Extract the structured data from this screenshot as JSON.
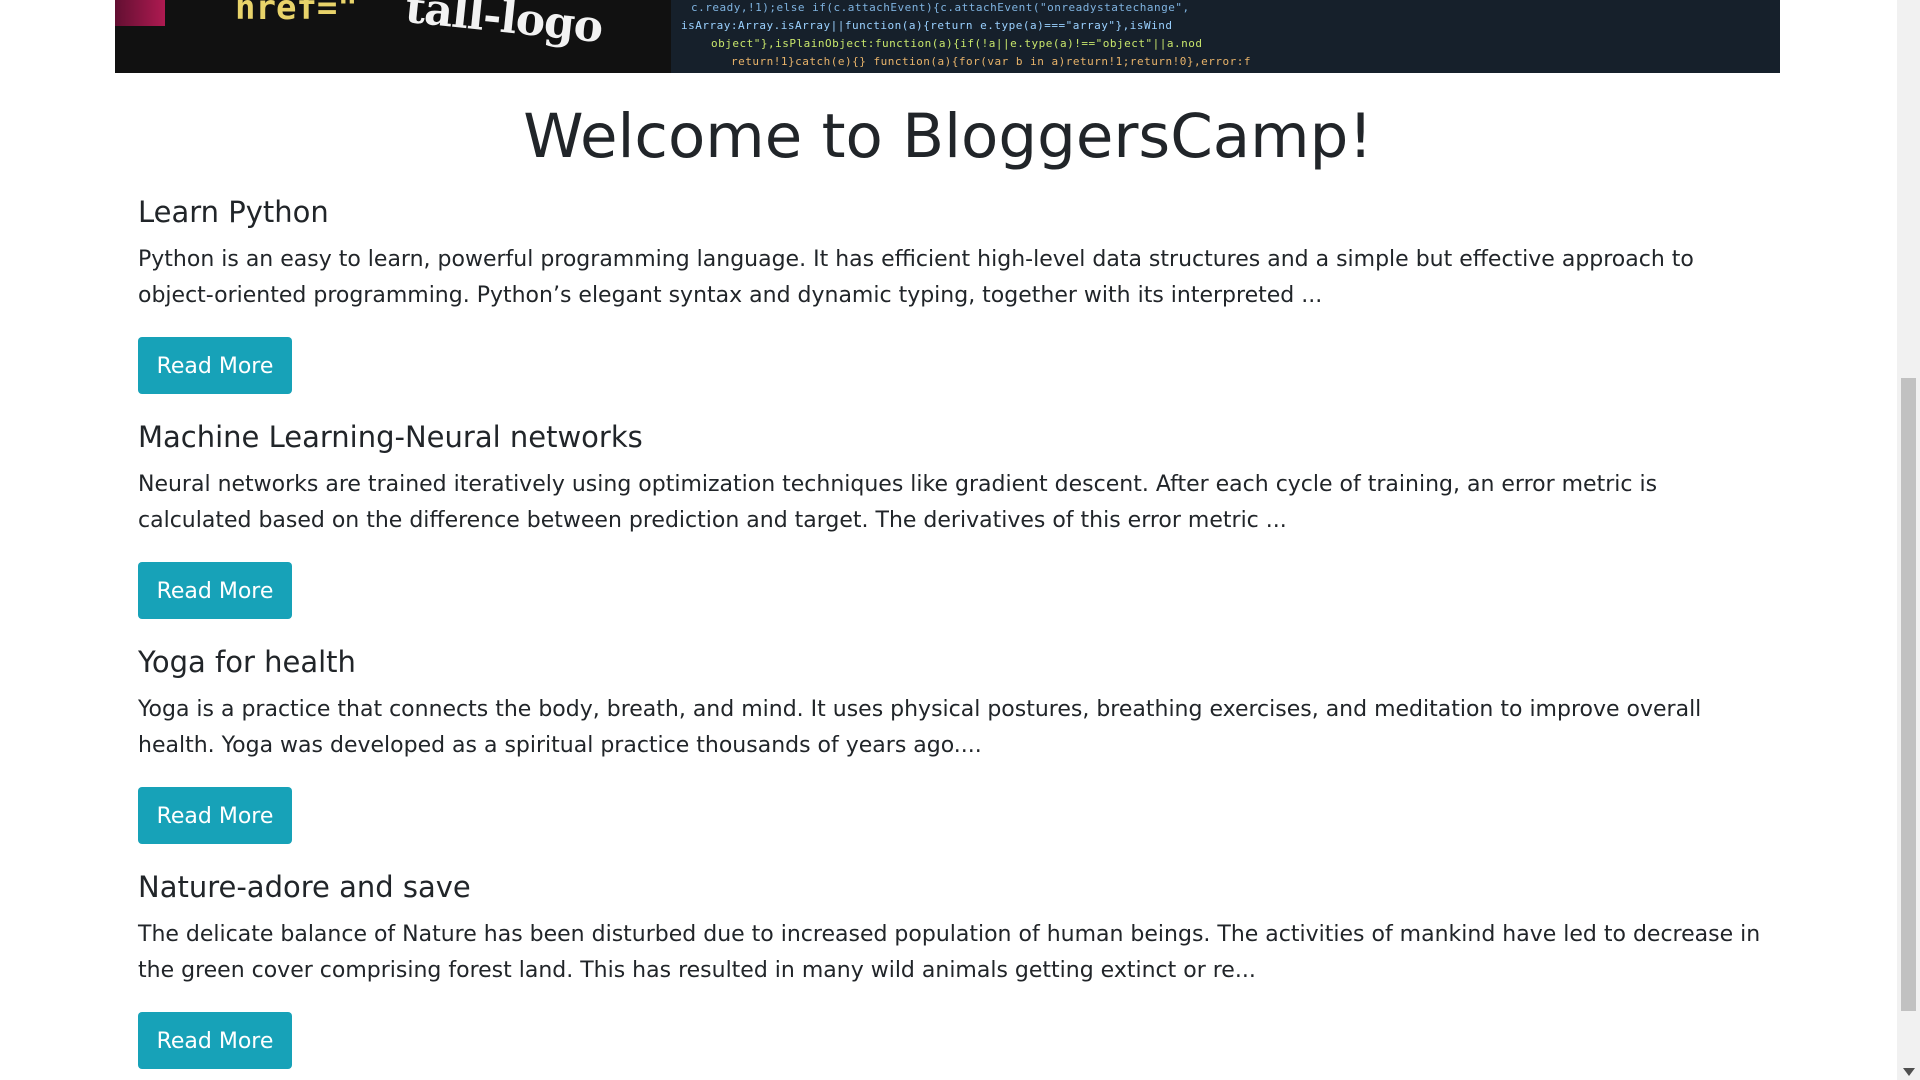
{
  "hero": {
    "logo_text": "tall-logo",
    "logo_attr": "href=\"",
    "code_lines": [
      "c.ready,!1);else if(c.attachEvent){c.attachEvent(\"onreadystatechange\",",
      "isArray:Array.isArray||function(a){return e.type(a)===\"array\"},isWind",
      "object\"},isPlainObject:function(a){if(!a||e.type(a)!==\"object\"||a.nod",
      "return!1}catch(e){} function(a){for(var b in a)return!1;return!0},error:f"
    ]
  },
  "page": {
    "title": "Welcome to BloggersCamp!"
  },
  "posts": [
    {
      "title": "Learn Python",
      "excerpt": "Python is an easy to learn, powerful programming language. It has efficient high-level data structures and a simple but effective approach to object-oriented programming. Python’s elegant syntax and dynamic typing, together with its interpreted ...",
      "button": "Read More"
    },
    {
      "title": "Machine Learning-Neural networks",
      "excerpt": "Neural networks are trained iteratively using optimization techniques like gradient descent. After each cycle of training, an error metric is calculated based on the difference between prediction and target. The derivatives of this error metric ...",
      "button": "Read More"
    },
    {
      "title": "Yoga for health",
      "excerpt": "Yoga is a practice that connects the body, breath, and mind. It uses physical postures, breathing exercises, and meditation to improve overall health. Yoga was developed as a spiritual practice thousands of years ago....",
      "button": "Read More"
    },
    {
      "title": "Nature-adore and save",
      "excerpt": "The delicate balance of Nature has been disturbed due to increased population of human beings. The activities of mankind have led to decrease in the green cover comprising forest land. This has resulted in many wild animals getting extinct or re...",
      "button": "Read More"
    }
  ],
  "colors": {
    "button_bg": "#17a2b8",
    "text": "#212529",
    "background": "#ffffff"
  }
}
